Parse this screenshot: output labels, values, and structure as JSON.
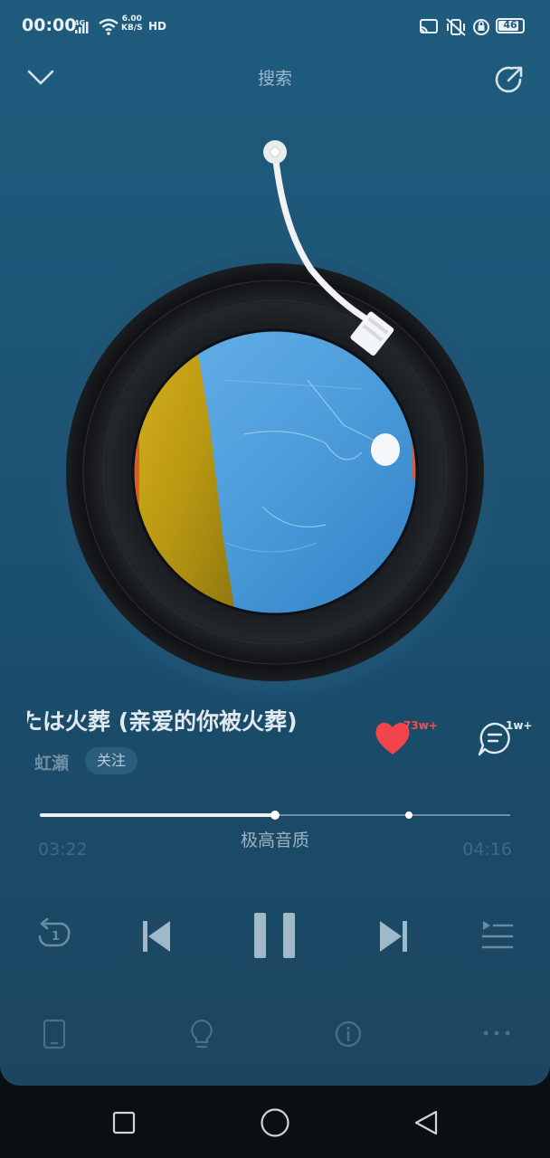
{
  "status_bar": {
    "time": "00:00",
    "network_type": "4G",
    "speed_value": "6.00",
    "speed_unit": "KB/S",
    "hd_label": "HD",
    "battery_level": "46",
    "icons": [
      "signal-icon",
      "wifi-icon",
      "cast-icon",
      "vibrate-mute-icon",
      "lock-rotation-icon",
      "battery-icon"
    ]
  },
  "header": {
    "title": "搜索",
    "collapse_icon": "chevron-down-icon",
    "share_icon": "share-icon"
  },
  "player": {
    "album_art_icon": "album-cover",
    "song_title": "たは火葬 (亲爱的你被火葬)",
    "artist": "虹瀬",
    "follow_label": "关注",
    "like_count": "73w+",
    "comment_count": "1w+",
    "quality": "极高音质",
    "current_time": "03:22",
    "total_time": "04:16",
    "progress_fraction": 0.5,
    "marker_fraction": 0.785
  },
  "controls": {
    "repeat_icon": "repeat-one-icon",
    "previous_icon": "skip-previous-icon",
    "play_pause_icon": "pause-icon",
    "next_icon": "skip-next-icon",
    "playlist_icon": "playlist-icon"
  },
  "bottom_actions": {
    "device_icon": "phone-device-icon",
    "idea_icon": "lightbulb-icon",
    "info_icon": "info-icon",
    "more_icon": "more-icon"
  },
  "navigation": {
    "recents_icon": "square-icon",
    "home_icon": "circle-icon",
    "back_icon": "triangle-back-icon"
  },
  "colors": {
    "background_top": "#1f5b7c",
    "background_bottom": "#1c4560",
    "like_red": "#f2444a",
    "text_primary": "#dfe9ef"
  }
}
